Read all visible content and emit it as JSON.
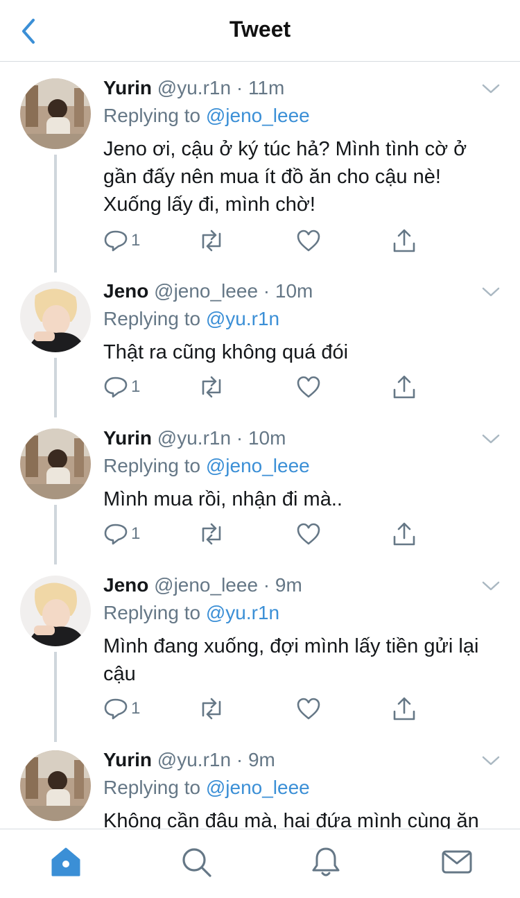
{
  "header": {
    "title": "Tweet"
  },
  "tweets": [
    {
      "name": "Yurin",
      "handle": "@yu.r1n",
      "dot": "·",
      "time": "11m",
      "replying_prefix": "Replying to",
      "replying_to": "@jeno_leee",
      "lines": [
        "Jeno ơi, cậu ở ký túc hả? Mình tình cờ ở",
        "gần đấy nên mua ít đồ ăn cho cậu nè!",
        "Xuống lấy đi, mình chờ!"
      ],
      "reply_count": "1"
    },
    {
      "name": "Jeno",
      "handle": "@jeno_leee",
      "dot": "·",
      "time": "10m",
      "replying_prefix": "Replying to",
      "replying_to": "@yu.r1n",
      "lines": [
        "Thật ra cũng không quá đói"
      ],
      "reply_count": "1"
    },
    {
      "name": "Yurin",
      "handle": "@yu.r1n",
      "dot": "·",
      "time": "10m",
      "replying_prefix": "Replying to",
      "replying_to": "@jeno_leee",
      "lines": [
        "Mình mua rồi, nhận đi mà.."
      ],
      "reply_count": "1"
    },
    {
      "name": "Jeno",
      "handle": "@jeno_leee",
      "dot": "·",
      "time": "9m",
      "replying_prefix": "Replying to",
      "replying_to": "@yu.r1n",
      "lines": [
        "Mình đang xuống, đợi mình lấy tiền gửi lại",
        "cậu"
      ],
      "reply_count": "1"
    },
    {
      "name": "Yurin",
      "handle": "@yu.r1n",
      "dot": "·",
      "time": "9m",
      "replying_prefix": "Replying to",
      "replying_to": "@jeno_leee",
      "lines": [
        "Không cần đâu mà, hai đứa mình cùng ăn"
      ],
      "reply_count": ""
    }
  ],
  "icons": {
    "back": "chevron-left-icon",
    "more": "chevron-down-icon",
    "reply": "reply-icon",
    "retweet": "retweet-icon",
    "like": "heart-icon",
    "share": "share-icon",
    "home": "home-icon",
    "search": "search-icon",
    "notifications": "bell-icon",
    "messages": "mail-icon"
  },
  "colors": {
    "accent": "#3b8fd6",
    "muted": "#657786",
    "text": "#14171a",
    "divider": "#d6dbe0"
  }
}
